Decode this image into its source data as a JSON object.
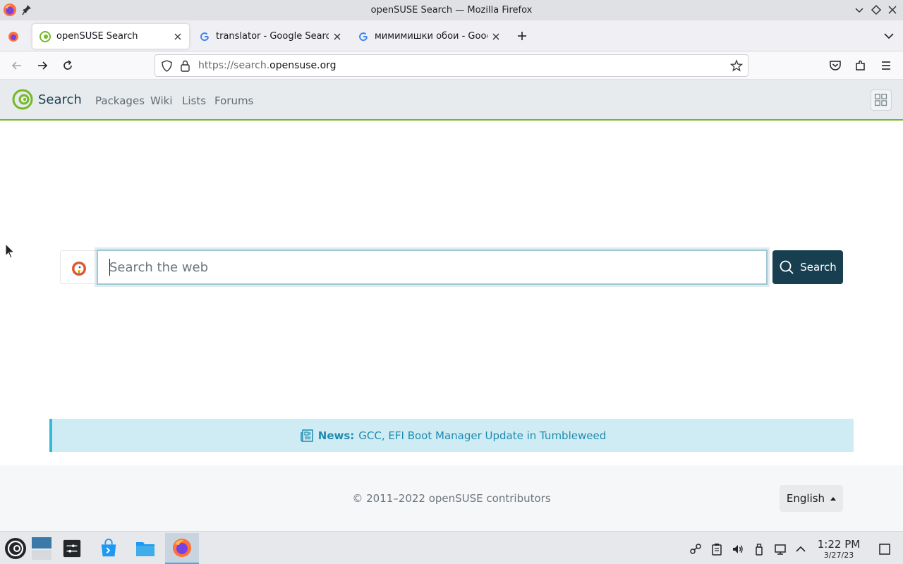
{
  "window": {
    "title": "openSUSE Search — Mozilla Firefox"
  },
  "tabs": [
    {
      "label": "openSUSE Search",
      "active": true,
      "favicon": "opensuse-icon"
    },
    {
      "label": "translator - Google Search",
      "active": false,
      "favicon": "google-icon"
    },
    {
      "label": "мимимишки обои - Goog",
      "active": false,
      "favicon": "google-icon"
    }
  ],
  "navbar": {
    "url_prefix": "https://search.",
    "url_domain": "opensuse.org"
  },
  "site": {
    "brand": "Search",
    "nav": [
      "Packages",
      "Wiki",
      "Lists",
      "Forums"
    ]
  },
  "search": {
    "placeholder": "Search the web",
    "value": "",
    "button_label": "Search",
    "engine_icon": "duckduckgo-icon"
  },
  "news": {
    "label": "News:",
    "text": "GCC, EFI Boot Manager Update in Tumbleweed"
  },
  "footer": {
    "copyright": "© 2011–2022 openSUSE contributors",
    "language": "English"
  },
  "taskbar": {
    "time": "1:22 PM",
    "date": "3/27/23"
  },
  "colors": {
    "accent_green": "#73ba25",
    "button_dark": "#173f4f",
    "news_bg": "#cfecf5",
    "news_text": "#1e8bb0",
    "taskbar_active": "#3daee9"
  }
}
